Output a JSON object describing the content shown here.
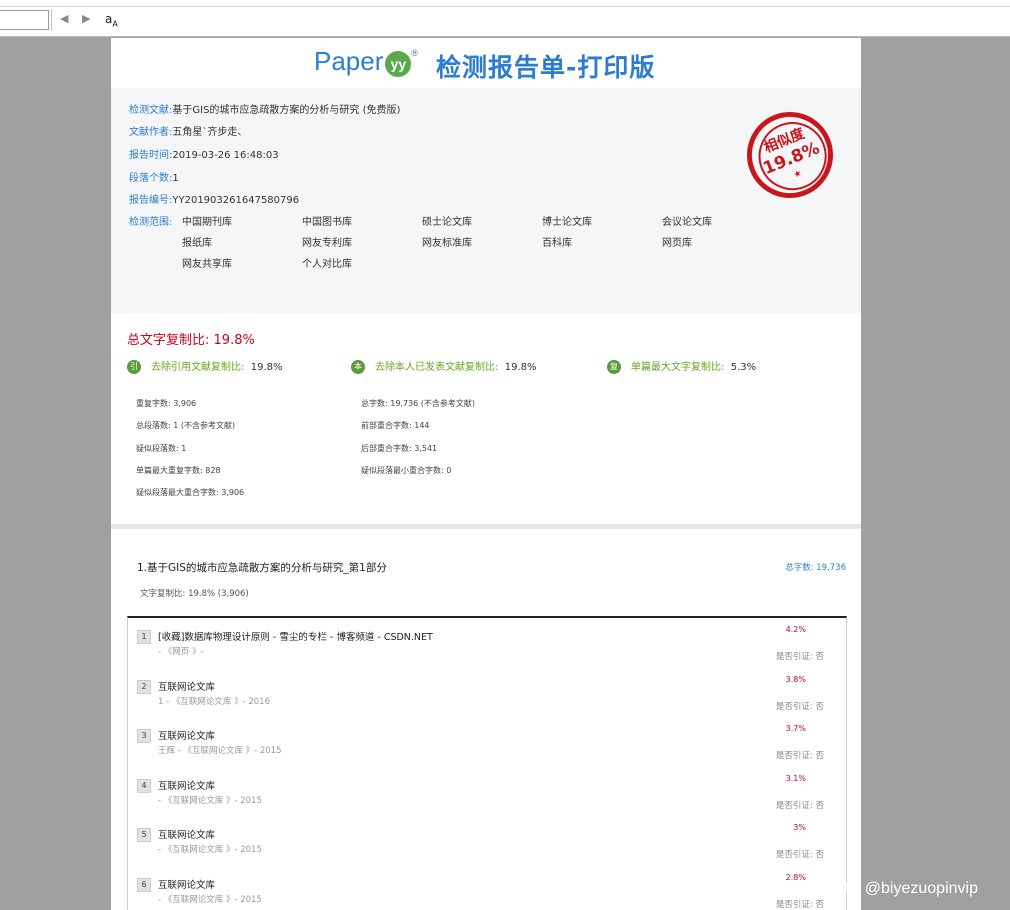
{
  "toolbar": {
    "prev_label": "◀",
    "next_label": "▶",
    "find_label": "a"
  },
  "header": {
    "logo_text": "Paper",
    "logo_badge": "yy",
    "logo_reg": "®",
    "title": "检测报告单-打印版"
  },
  "info": {
    "doc_label": "检测文献:",
    "doc_value": "基于GIS的城市应急疏散方案的分析与研究 (免费版)",
    "author_label": "文献作者:",
    "author_value": "五角星`齐步走、",
    "time_label": "报告时间:",
    "time_value": "2019-03-26 16:48:03",
    "para_label": "段落个数:",
    "para_value": "1",
    "id_label": "报告编号:",
    "id_value": "YY201903261647580796",
    "scope_label": "检测范围:",
    "scope": [
      "中国期刊库",
      "中国图书库",
      "硕士论文库",
      "博士论文库",
      "会议论文库",
      "报纸库",
      "网友专利库",
      "网友标准库",
      "百科库",
      "网页库",
      "网友共享库",
      "个人对比库"
    ]
  },
  "stamp": {
    "label": "相似度",
    "value": "19.8%",
    "star": "★"
  },
  "summary": {
    "total_label": "总文字复制比:",
    "total_value": "19.8%",
    "metrics": [
      {
        "icon": "引",
        "label": "去除引用文献复制比:",
        "value": "19.8%"
      },
      {
        "icon": "本",
        "label": "去除本人已发表文献复制比:",
        "value": "19.8%"
      },
      {
        "icon": "复",
        "label": "单篇最大文字复制比:",
        "value": "5.3%"
      }
    ],
    "stats_left": [
      "重复字数: 3,906",
      "总段落数: 1 (不含参考文献)",
      "疑似段落数: 1",
      "单篇最大重复字数: 828",
      "疑似段落最大重合字数: 3,906"
    ],
    "stats_right": [
      "总字数: 19,736 (不含参考文献)",
      "前部重合字数: 144",
      "后部重合字数: 3,541",
      "疑似段落最小重合字数: 0"
    ]
  },
  "part": {
    "title": "1.基于GIS的城市应急疏散方案的分析与研究_第1部分",
    "total": "总字数: 19,736",
    "ratio": "文字复制比: 19.8% (3,906)"
  },
  "items": [
    {
      "num": "1",
      "source": "[收藏]数据库物理设计原则 - 雪尘的专栏 - 博客频道 - CSDN.NET",
      "sub": "- 《网页 》-",
      "pct": "4.2%",
      "cite": "是否引证: 否"
    },
    {
      "num": "2",
      "source": "互联网论文库",
      "sub": "1 - 《互联网论文库 》- 2016",
      "pct": "3.8%",
      "cite": "是否引证: 否"
    },
    {
      "num": "3",
      "source": "互联网论文库",
      "sub": "王辉 - 《互联网论文库 》- 2015",
      "pct": "3.7%",
      "cite": "是否引证: 否"
    },
    {
      "num": "4",
      "source": "互联网论文库",
      "sub": "- 《互联网论文库 》- 2015",
      "pct": "3.1%",
      "cite": "是否引证: 否"
    },
    {
      "num": "5",
      "source": "互联网论文库",
      "sub": "- 《互联网论文库 》- 2015",
      "pct": "3%",
      "cite": "是否引证: 否"
    },
    {
      "num": "6",
      "source": "互联网论文库",
      "sub": "- 《互联网论文库 》- 2015",
      "pct": "2.8%",
      "cite": "是否引证: 否"
    }
  ],
  "watermark": "CSDN @biyezuopinvip"
}
